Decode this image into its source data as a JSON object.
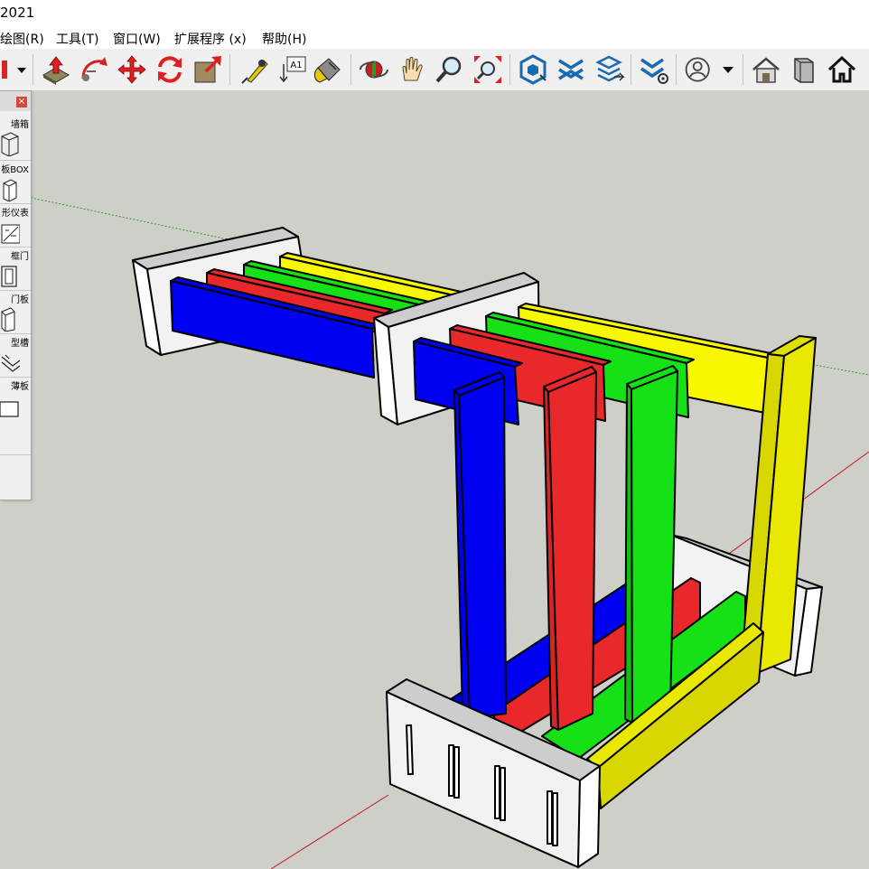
{
  "window": {
    "title": "2021"
  },
  "menu": [
    {
      "label": "绘图(R)"
    },
    {
      "label": "工具(T)"
    },
    {
      "label": "窗口(W)"
    },
    {
      "label": "扩展程序 (x)"
    },
    {
      "label": "帮助(H)"
    }
  ],
  "toolbar": {
    "tools": [
      {
        "icon": "paint-dropdown-icon"
      },
      {
        "icon": "push-pull-icon"
      },
      {
        "icon": "follow-me-icon"
      },
      {
        "icon": "move-icon"
      },
      {
        "icon": "rotate-icon"
      },
      {
        "icon": "scale-icon"
      },
      {
        "icon": "tape-measure-icon"
      },
      {
        "icon": "text-icon",
        "text": "A1"
      },
      {
        "icon": "paint-bucket-icon"
      },
      {
        "icon": "orbit-icon"
      },
      {
        "icon": "pan-icon"
      },
      {
        "icon": "zoom-icon"
      },
      {
        "icon": "zoom-extents-icon"
      },
      {
        "icon": "extension-1-icon"
      },
      {
        "icon": "extension-2-icon"
      },
      {
        "icon": "extension-3-icon"
      },
      {
        "icon": "extension-4-icon"
      },
      {
        "icon": "account-icon"
      },
      {
        "icon": "warehouse-icon"
      },
      {
        "icon": "component-icon"
      },
      {
        "icon": "home-icon"
      }
    ]
  },
  "tray": {
    "close": "×",
    "items": [
      {
        "label": "墙箱",
        "icon": "wall-box-icon"
      },
      {
        "label": "板BOX",
        "icon": "board-box-icon"
      },
      {
        "label": "形仪表",
        "icon": "shape-icon"
      },
      {
        "label": "框门",
        "icon": "frame-door-icon"
      },
      {
        "label": "门板",
        "icon": "door-panel-icon"
      },
      {
        "label": "型槽",
        "icon": "groove-icon"
      },
      {
        "label": "薄板",
        "icon": "thin-board-icon"
      }
    ]
  },
  "colors": {
    "viewport_bg": "#cfcfc9",
    "blue": "#0000f0",
    "red": "#e8282a",
    "green": "#16e016",
    "yellow": "#f8f800",
    "dark_yellow": "#d8d800",
    "white_panel": "#f2f2f2",
    "panel_top": "#cdcdcd"
  }
}
